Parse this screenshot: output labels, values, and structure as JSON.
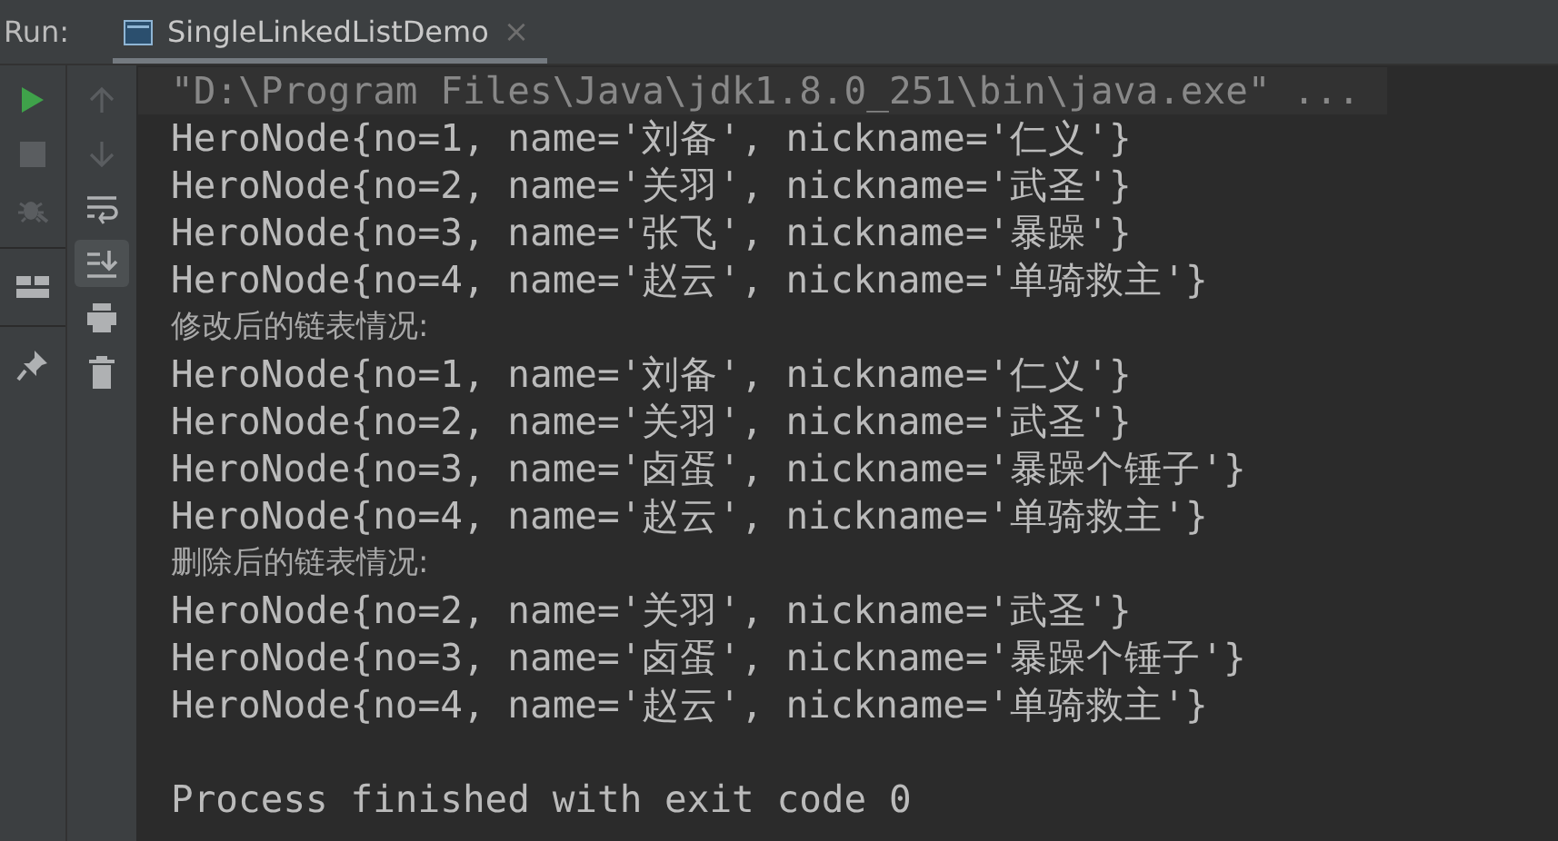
{
  "run_label": "Run:",
  "tabs": [
    {
      "label": "SingleLinkedListDemo",
      "close": "×",
      "selected": true
    }
  ],
  "left_toolbar": [
    {
      "disabled": false
    },
    {
      "disabled": true
    },
    {
      "disabled": true
    },
    {
      "disabled": false
    },
    {
      "disabled": false
    }
  ],
  "right_toolbar": [
    {
      "disabled": true,
      "selected": false
    },
    {
      "disabled": true,
      "selected": false
    },
    {
      "disabled": false,
      "selected": false
    },
    {
      "disabled": false,
      "selected": true
    },
    {
      "disabled": false,
      "selected": false
    },
    {
      "disabled": false,
      "selected": false
    }
  ],
  "console": [
    {
      "kind": "command",
      "text": "\"D:\\Program Files\\Java\\jdk1.8.0_251\\bin\\java.exe\" ..."
    },
    {
      "kind": "output",
      "text": "HeroNode{no=1, name='刘备', nickname='仁义'}"
    },
    {
      "kind": "output",
      "text": "HeroNode{no=2, name='关羽', nickname='武圣'}"
    },
    {
      "kind": "output",
      "text": "HeroNode{no=3, name='张飞', nickname='暴躁'}"
    },
    {
      "kind": "output",
      "text": "HeroNode{no=4, name='赵云', nickname='单骑救主'}"
    },
    {
      "kind": "heading",
      "text": "修改后的链表情况:"
    },
    {
      "kind": "output",
      "text": "HeroNode{no=1, name='刘备', nickname='仁义'}"
    },
    {
      "kind": "output",
      "text": "HeroNode{no=2, name='关羽', nickname='武圣'}"
    },
    {
      "kind": "output",
      "text": "HeroNode{no=3, name='卤蛋', nickname='暴躁个锤子'}"
    },
    {
      "kind": "output",
      "text": "HeroNode{no=4, name='赵云', nickname='单骑救主'}"
    },
    {
      "kind": "heading",
      "text": "删除后的链表情况:"
    },
    {
      "kind": "output",
      "text": "HeroNode{no=2, name='关羽', nickname='武圣'}"
    },
    {
      "kind": "output",
      "text": "HeroNode{no=3, name='卤蛋', nickname='暴躁个锤子'}"
    },
    {
      "kind": "output",
      "text": "HeroNode{no=4, name='赵云', nickname='单骑救主'}"
    },
    {
      "kind": "exit",
      "text": "Process finished with exit code 0"
    }
  ]
}
